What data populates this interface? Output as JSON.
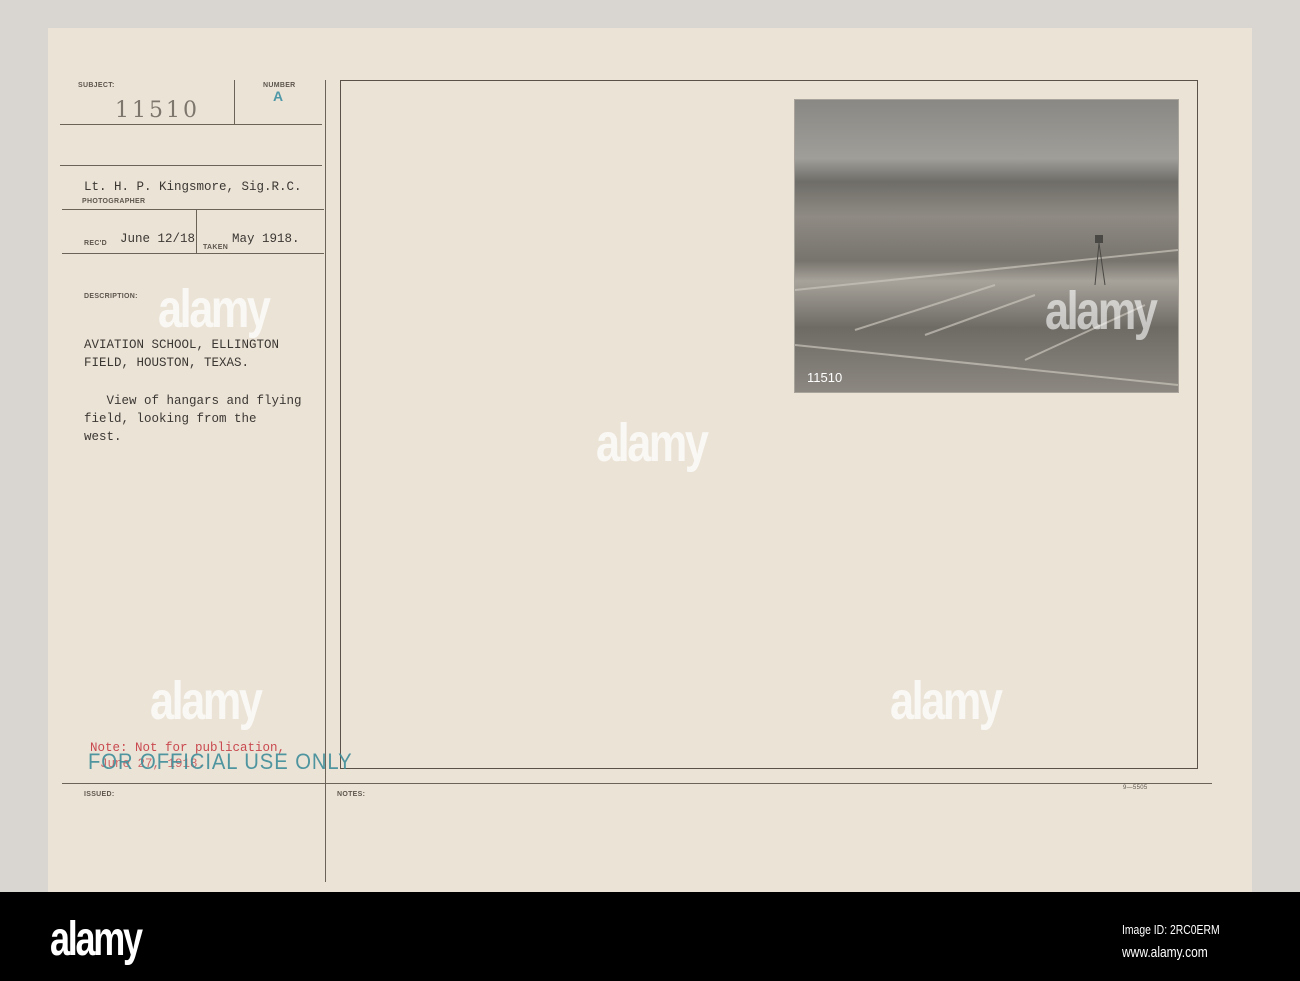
{
  "card": {
    "subject_label": "SUBJECT:",
    "subject_value": "11510",
    "number_label": "NUMBER",
    "number_value": "A",
    "photographer_value": "Lt. H. P. Kingsmore, Sig.R.C.",
    "photographer_label": "PHOTOGRAPHER",
    "recd_label": "REC'D",
    "recd_value": "June 12/18",
    "taken_label": "TAKEN",
    "taken_value": "May 1918.",
    "description_label": "DESCRIPTION:",
    "description_title": "AVIATION SCHOOL, ELLINGTON\nFIELD, HOUSTON, TEXAS.",
    "description_text": "   View of hangars and flying\nfield, looking from the\nwest.",
    "note": "Note: Not for publication,",
    "note_date": "June 27, 1918.",
    "stamp": "FOR OFFICIAL USE ONLY",
    "issued_label": "ISSUED:",
    "notes_label": "NOTES:",
    "form_number": "9—5505",
    "photo_caption": "11510"
  },
  "colors": {
    "paper": "#ebe3d6",
    "stamp": "#3f8d9a",
    "red_ink": "#c9494f"
  },
  "footer": {
    "logo": "alamy",
    "image_id": "Image ID: 2RC0ERM",
    "url": "www.alamy.com"
  },
  "watermark": "alamy"
}
